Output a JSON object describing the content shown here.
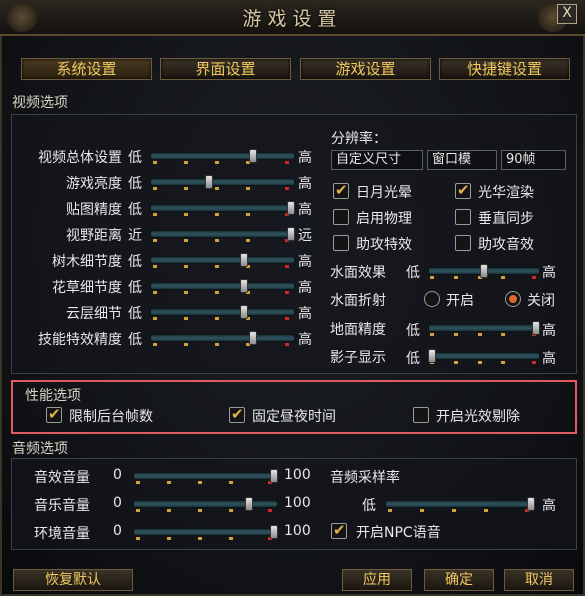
{
  "window": {
    "title": "游戏设置",
    "close_label": "X"
  },
  "tabs": [
    {
      "label": "系统设置",
      "active": true
    },
    {
      "label": "界面设置",
      "active": false
    },
    {
      "label": "游戏设置",
      "active": false
    },
    {
      "label": "快捷键设置",
      "active": false
    }
  ],
  "video": {
    "section_label": "视频选项",
    "sliders": [
      {
        "label": "视频总体设置",
        "low": "低",
        "high": "高",
        "value": 0.72
      },
      {
        "label": "游戏亮度",
        "low": "低",
        "high": "高",
        "value": 0.4
      },
      {
        "label": "贴图精度",
        "low": "低",
        "high": "高",
        "value": 1.0
      },
      {
        "label": "视野距离",
        "low": "近",
        "high": "远",
        "value": 1.0
      },
      {
        "label": "树木细节度",
        "low": "低",
        "high": "高",
        "value": 0.66
      },
      {
        "label": "花草细节度",
        "low": "低",
        "high": "高",
        "value": 0.66
      },
      {
        "label": "云层细节",
        "low": "低",
        "high": "高",
        "value": 0.66
      },
      {
        "label": "技能特效精度",
        "low": "低",
        "high": "高",
        "value": 0.72
      }
    ],
    "resolution": {
      "label": "分辨率：",
      "mode": "自定义尺寸",
      "window": "窗口模",
      "fps": "90帧"
    },
    "checkboxes": [
      {
        "label": "日月光晕",
        "checked": true
      },
      {
        "label": "光华渲染",
        "checked": true
      },
      {
        "label": "启用物理",
        "checked": false
      },
      {
        "label": "垂直同步",
        "checked": false
      },
      {
        "label": "助攻特效",
        "checked": false
      },
      {
        "label": "助攻音效",
        "checked": false
      }
    ],
    "water_effect": {
      "label": "水面效果",
      "low": "低",
      "high": "高",
      "value": 0.5
    },
    "water_reflection": {
      "label": "水面折射",
      "on_label": "开启",
      "off_label": "关闭",
      "selected": "关闭"
    },
    "ground_detail": {
      "label": "地面精度",
      "low": "低",
      "high": "高",
      "value": 1.0
    },
    "shadow": {
      "label": "影子显示",
      "low": "低",
      "high": "高",
      "value": 0.0
    }
  },
  "performance": {
    "section_label": "性能选项",
    "options": [
      {
        "label": "限制后台帧数",
        "checked": true
      },
      {
        "label": "固定昼夜时间",
        "checked": true
      },
      {
        "label": "开启光效剔除",
        "checked": false
      }
    ]
  },
  "audio": {
    "section_label": "音频选项",
    "sliders": [
      {
        "label": "音效音量",
        "low": "0",
        "high": "100",
        "value": 1.0
      },
      {
        "label": "音乐音量",
        "low": "0",
        "high": "100",
        "value": 0.82
      },
      {
        "label": "环境音量",
        "low": "0",
        "high": "100",
        "value": 1.0
      }
    ],
    "sample_rate": {
      "label": "音频采样率",
      "low": "低",
      "high": "高",
      "value": 1.0
    },
    "npc_voice": {
      "label": "开启NPC语音",
      "checked": true
    }
  },
  "footer": {
    "restore_label": "恢复默认",
    "apply_label": "应用",
    "ok_label": "确定",
    "cancel_label": "取消"
  }
}
